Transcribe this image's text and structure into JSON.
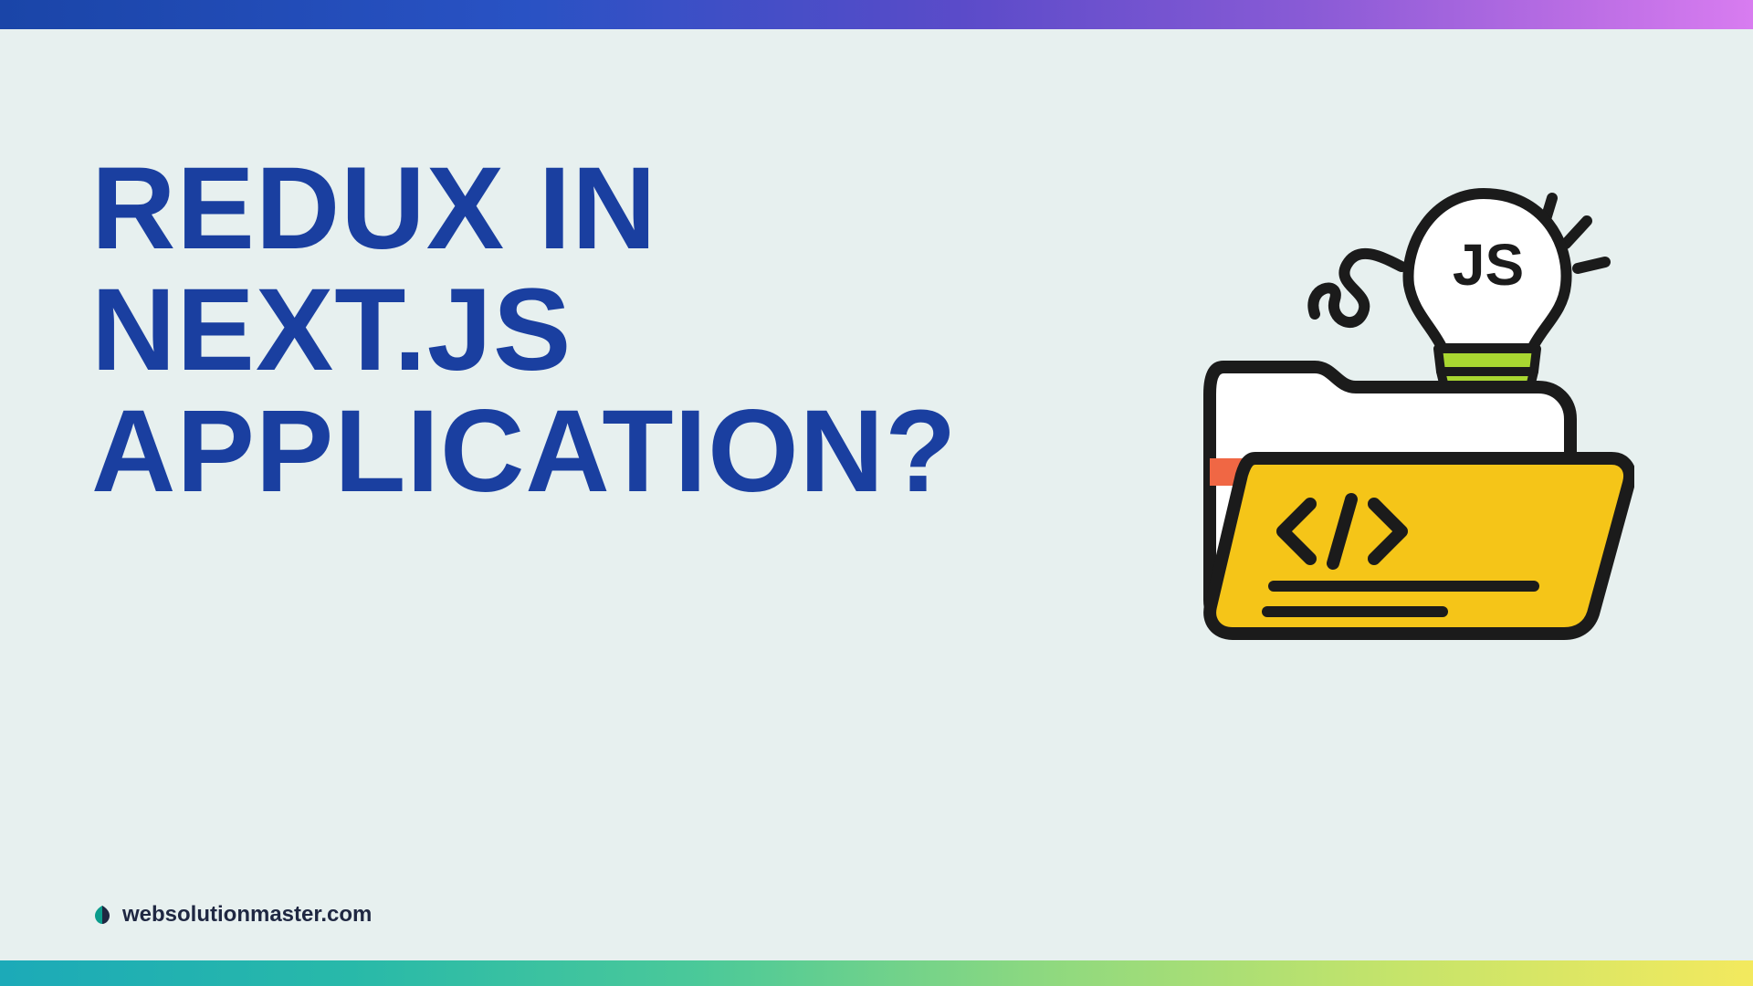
{
  "page": {
    "title_line1": "Redux in",
    "title_line2": "Next.JS",
    "title_line3": "Application?"
  },
  "footer": {
    "brand_text": "websolutionmaster.com"
  },
  "illustration": {
    "bulb_label": "JS"
  },
  "colors": {
    "title": "#1a3fa0",
    "background": "#e7f0ef",
    "folder_front": "#f5c518",
    "folder_back_accent": "#f06744",
    "bulb_neck": "#a9d731",
    "bulb_base": "#f06744",
    "brand_logo_left": "#0b9c8c",
    "brand_logo_right": "#1f2742"
  }
}
